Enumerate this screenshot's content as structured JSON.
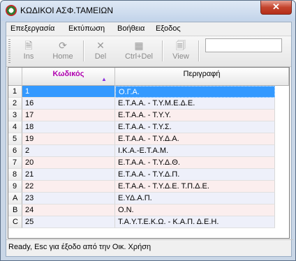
{
  "window": {
    "title": "ΚΩΔΙΚΟΙ ΑΣΦ.ΤΑΜΕΙΩΝ",
    "close_label": "✕"
  },
  "menu": {
    "items": [
      "Επεξεργασία",
      "Εκτύπωση",
      "Βοήθεια",
      "Εξοδος"
    ]
  },
  "toolbar": {
    "buttons": [
      {
        "label": "Ins",
        "icon": "new-document-icon"
      },
      {
        "label": "Home",
        "icon": "home-icon"
      },
      {
        "label": "Del",
        "icon": "delete-x-icon"
      },
      {
        "label": "Ctrl+Del",
        "icon": "ctrl-delete-icon"
      },
      {
        "label": "View",
        "icon": "view-document-icon"
      }
    ],
    "search_value": ""
  },
  "grid": {
    "columns": {
      "code": "Κωδικός",
      "description": "Περιγραφή"
    },
    "rows": [
      {
        "rh": "1",
        "code": "1",
        "desc": "Ο.Γ.Α."
      },
      {
        "rh": "2",
        "code": "16",
        "desc": "Ε.Τ.Α.Α. - Τ.Υ.Μ.Ε.Δ.Ε."
      },
      {
        "rh": "3",
        "code": "17",
        "desc": "Ε.Τ.Α.Α. - Τ.Υ.Υ."
      },
      {
        "rh": "4",
        "code": "18",
        "desc": "Ε.Τ.Α.Α. - Τ.Υ.Σ."
      },
      {
        "rh": "5",
        "code": "19",
        "desc": "Ε.Τ.Α.Α. - Τ.Υ.Δ.Α."
      },
      {
        "rh": "6",
        "code": "2",
        "desc": "Ι.Κ.Α.-Ε.Τ.Α.Μ."
      },
      {
        "rh": "7",
        "code": "20",
        "desc": "Ε.Τ.Α.Α. - Τ.Υ.Δ.Θ."
      },
      {
        "rh": "8",
        "code": "21",
        "desc": "Ε.Τ.Α.Α. - Τ.Υ.Δ.Π."
      },
      {
        "rh": "9",
        "code": "22",
        "desc": "Ε.Τ.Α.Α. - Τ.Υ.Δ.Ε. Τ.Π.Δ.Ε."
      },
      {
        "rh": "A",
        "code": "23",
        "desc": "Ε.ΥΔ.Α.Π."
      },
      {
        "rh": "B",
        "code": "24",
        "desc": "Ο.Ν."
      },
      {
        "rh": "C",
        "code": "25",
        "desc": "Τ.Α.Υ.Τ.Ε.Κ.Ω. - Κ.Α.Π. Δ.Ε.Η."
      }
    ]
  },
  "status": {
    "text": "Ready, Esc για έξοδο από την Οικ. Χρήση"
  },
  "colors": {
    "selection": "#3399ff",
    "header_code": "#b000b0",
    "row_odd": "#fbeeee",
    "row_even": "#eef0fa"
  }
}
